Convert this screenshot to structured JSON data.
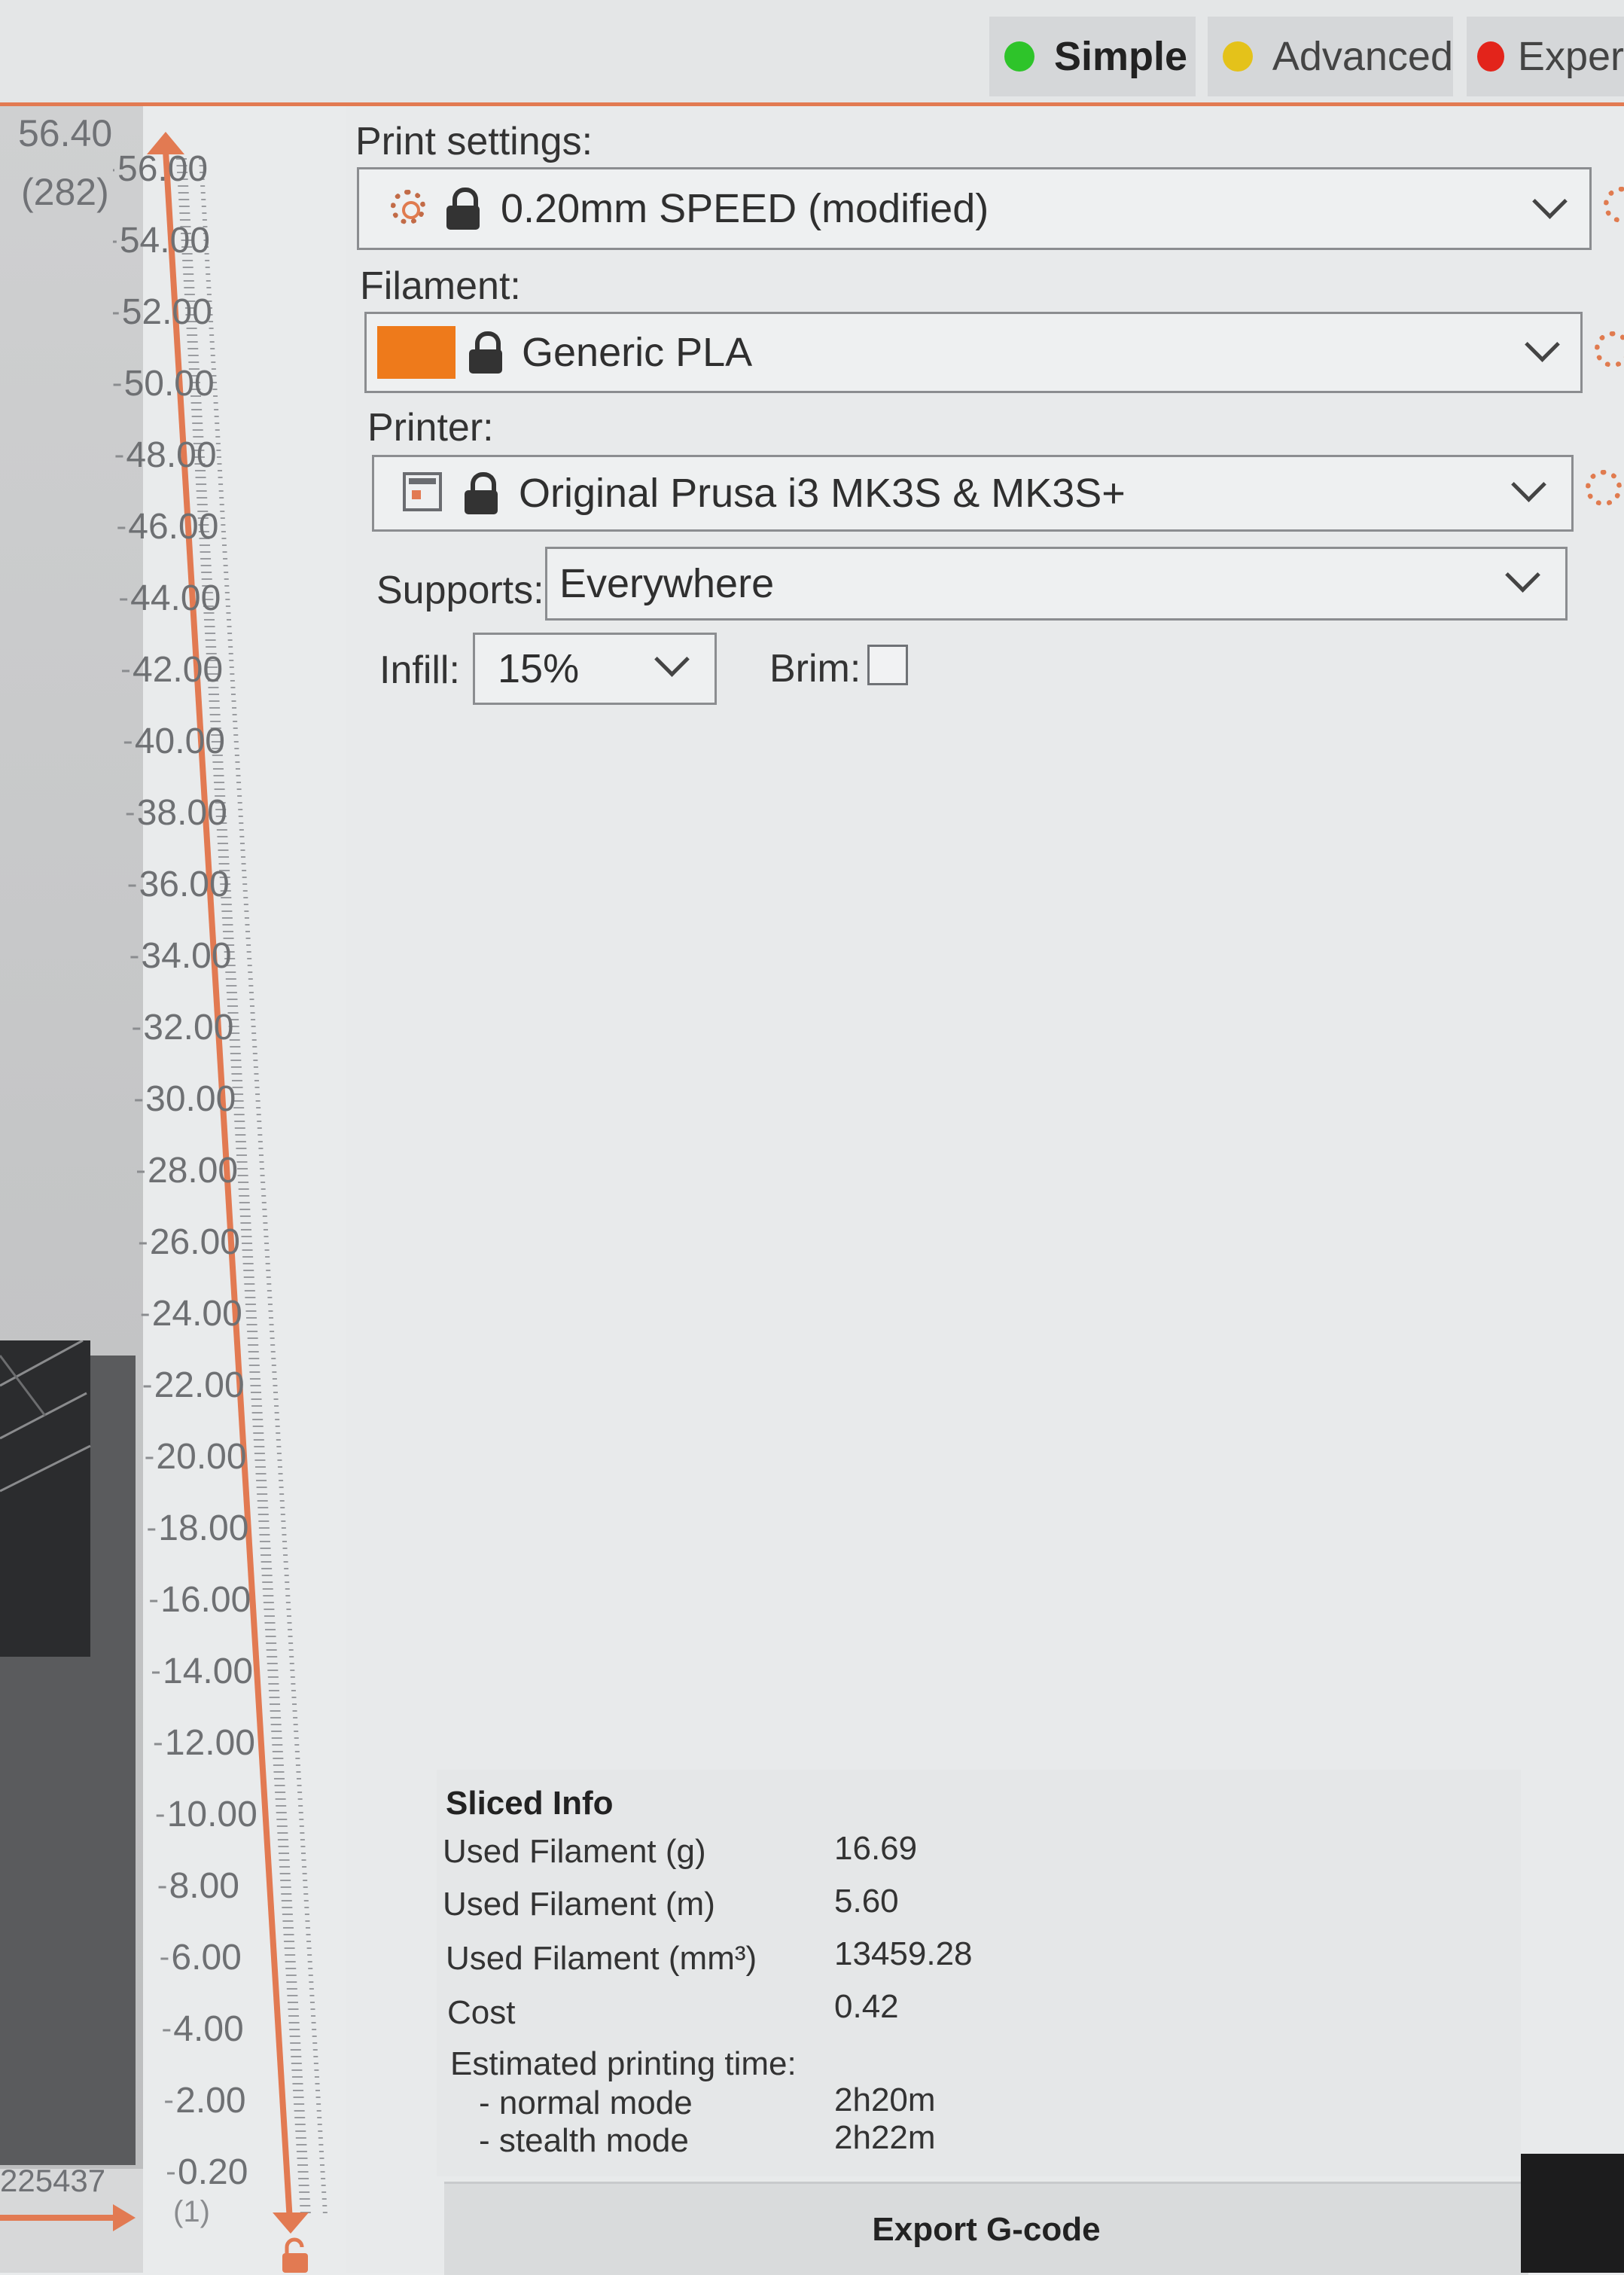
{
  "modes": {
    "simple": {
      "label": "Simple",
      "color": "#2ec42a"
    },
    "advanced": {
      "label": "Advanced",
      "color": "#e4c21a"
    },
    "expert": {
      "label": "Exper",
      "color": "#e3241b"
    }
  },
  "preview": {
    "top_height": "56.40",
    "top_layer": "(282)",
    "moves_count": "225437"
  },
  "layer_slider": {
    "ticks": [
      "56.00",
      "54.00",
      "52.00",
      "50.00",
      "48.00",
      "46.00",
      "44.00",
      "42.00",
      "40.00",
      "38.00",
      "36.00",
      "34.00",
      "32.00",
      "30.00",
      "28.00",
      "26.00",
      "24.00",
      "22.00",
      "20.00",
      "18.00",
      "16.00",
      "14.00",
      "12.00",
      "10.00",
      "8.00",
      "6.00",
      "4.00",
      "2.00",
      "0.20"
    ],
    "bottom_layer": "(1)",
    "accent": "#e27a52"
  },
  "sidebar": {
    "print_settings": {
      "label": "Print settings:",
      "value": "0.20mm SPEED (modified)"
    },
    "filament": {
      "label": "Filament:",
      "value": "Generic PLA",
      "color": "#ee7a1b"
    },
    "printer": {
      "label": "Printer:",
      "value": "Original Prusa i3 MK3S & MK3S+"
    },
    "supports": {
      "label": "Supports:",
      "value": "Everywhere"
    },
    "infill": {
      "label": "Infill:",
      "value": "15%"
    },
    "brim": {
      "label": "Brim:",
      "checked": false
    }
  },
  "sliced_info": {
    "title": "Sliced Info",
    "rows": [
      {
        "label": "Used Filament (g)",
        "value": "16.69"
      },
      {
        "label": "Used Filament (m)",
        "value": "5.60"
      },
      {
        "label": "Used Filament (mm³)",
        "value": "13459.28"
      },
      {
        "label": "Cost",
        "value": "0.42"
      }
    ],
    "time_label": "Estimated printing time:",
    "times": [
      {
        "label": "- normal mode",
        "value": "2h20m"
      },
      {
        "label": "- stealth mode",
        "value": "2h22m"
      }
    ]
  },
  "export_button": {
    "label": "Export G-code"
  }
}
